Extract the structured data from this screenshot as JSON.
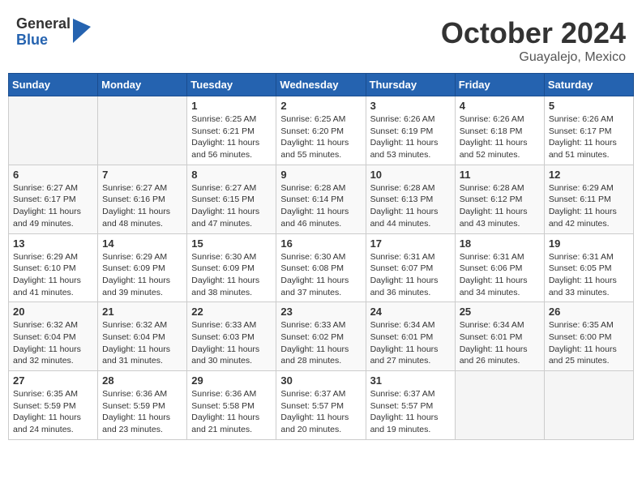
{
  "header": {
    "logo": {
      "general": "General",
      "blue": "Blue"
    },
    "month": "October 2024",
    "location": "Guayalejo, Mexico"
  },
  "weekdays": [
    "Sunday",
    "Monday",
    "Tuesday",
    "Wednesday",
    "Thursday",
    "Friday",
    "Saturday"
  ],
  "weeks": [
    [
      {
        "day": "",
        "info": ""
      },
      {
        "day": "",
        "info": ""
      },
      {
        "day": "1",
        "info": "Sunrise: 6:25 AM\nSunset: 6:21 PM\nDaylight: 11 hours and 56 minutes."
      },
      {
        "day": "2",
        "info": "Sunrise: 6:25 AM\nSunset: 6:20 PM\nDaylight: 11 hours and 55 minutes."
      },
      {
        "day": "3",
        "info": "Sunrise: 6:26 AM\nSunset: 6:19 PM\nDaylight: 11 hours and 53 minutes."
      },
      {
        "day": "4",
        "info": "Sunrise: 6:26 AM\nSunset: 6:18 PM\nDaylight: 11 hours and 52 minutes."
      },
      {
        "day": "5",
        "info": "Sunrise: 6:26 AM\nSunset: 6:17 PM\nDaylight: 11 hours and 51 minutes."
      }
    ],
    [
      {
        "day": "6",
        "info": "Sunrise: 6:27 AM\nSunset: 6:17 PM\nDaylight: 11 hours and 49 minutes."
      },
      {
        "day": "7",
        "info": "Sunrise: 6:27 AM\nSunset: 6:16 PM\nDaylight: 11 hours and 48 minutes."
      },
      {
        "day": "8",
        "info": "Sunrise: 6:27 AM\nSunset: 6:15 PM\nDaylight: 11 hours and 47 minutes."
      },
      {
        "day": "9",
        "info": "Sunrise: 6:28 AM\nSunset: 6:14 PM\nDaylight: 11 hours and 46 minutes."
      },
      {
        "day": "10",
        "info": "Sunrise: 6:28 AM\nSunset: 6:13 PM\nDaylight: 11 hours and 44 minutes."
      },
      {
        "day": "11",
        "info": "Sunrise: 6:28 AM\nSunset: 6:12 PM\nDaylight: 11 hours and 43 minutes."
      },
      {
        "day": "12",
        "info": "Sunrise: 6:29 AM\nSunset: 6:11 PM\nDaylight: 11 hours and 42 minutes."
      }
    ],
    [
      {
        "day": "13",
        "info": "Sunrise: 6:29 AM\nSunset: 6:10 PM\nDaylight: 11 hours and 41 minutes."
      },
      {
        "day": "14",
        "info": "Sunrise: 6:29 AM\nSunset: 6:09 PM\nDaylight: 11 hours and 39 minutes."
      },
      {
        "day": "15",
        "info": "Sunrise: 6:30 AM\nSunset: 6:09 PM\nDaylight: 11 hours and 38 minutes."
      },
      {
        "day": "16",
        "info": "Sunrise: 6:30 AM\nSunset: 6:08 PM\nDaylight: 11 hours and 37 minutes."
      },
      {
        "day": "17",
        "info": "Sunrise: 6:31 AM\nSunset: 6:07 PM\nDaylight: 11 hours and 36 minutes."
      },
      {
        "day": "18",
        "info": "Sunrise: 6:31 AM\nSunset: 6:06 PM\nDaylight: 11 hours and 34 minutes."
      },
      {
        "day": "19",
        "info": "Sunrise: 6:31 AM\nSunset: 6:05 PM\nDaylight: 11 hours and 33 minutes."
      }
    ],
    [
      {
        "day": "20",
        "info": "Sunrise: 6:32 AM\nSunset: 6:04 PM\nDaylight: 11 hours and 32 minutes."
      },
      {
        "day": "21",
        "info": "Sunrise: 6:32 AM\nSunset: 6:04 PM\nDaylight: 11 hours and 31 minutes."
      },
      {
        "day": "22",
        "info": "Sunrise: 6:33 AM\nSunset: 6:03 PM\nDaylight: 11 hours and 30 minutes."
      },
      {
        "day": "23",
        "info": "Sunrise: 6:33 AM\nSunset: 6:02 PM\nDaylight: 11 hours and 28 minutes."
      },
      {
        "day": "24",
        "info": "Sunrise: 6:34 AM\nSunset: 6:01 PM\nDaylight: 11 hours and 27 minutes."
      },
      {
        "day": "25",
        "info": "Sunrise: 6:34 AM\nSunset: 6:01 PM\nDaylight: 11 hours and 26 minutes."
      },
      {
        "day": "26",
        "info": "Sunrise: 6:35 AM\nSunset: 6:00 PM\nDaylight: 11 hours and 25 minutes."
      }
    ],
    [
      {
        "day": "27",
        "info": "Sunrise: 6:35 AM\nSunset: 5:59 PM\nDaylight: 11 hours and 24 minutes."
      },
      {
        "day": "28",
        "info": "Sunrise: 6:36 AM\nSunset: 5:59 PM\nDaylight: 11 hours and 23 minutes."
      },
      {
        "day": "29",
        "info": "Sunrise: 6:36 AM\nSunset: 5:58 PM\nDaylight: 11 hours and 21 minutes."
      },
      {
        "day": "30",
        "info": "Sunrise: 6:37 AM\nSunset: 5:57 PM\nDaylight: 11 hours and 20 minutes."
      },
      {
        "day": "31",
        "info": "Sunrise: 6:37 AM\nSunset: 5:57 PM\nDaylight: 11 hours and 19 minutes."
      },
      {
        "day": "",
        "info": ""
      },
      {
        "day": "",
        "info": ""
      }
    ]
  ]
}
